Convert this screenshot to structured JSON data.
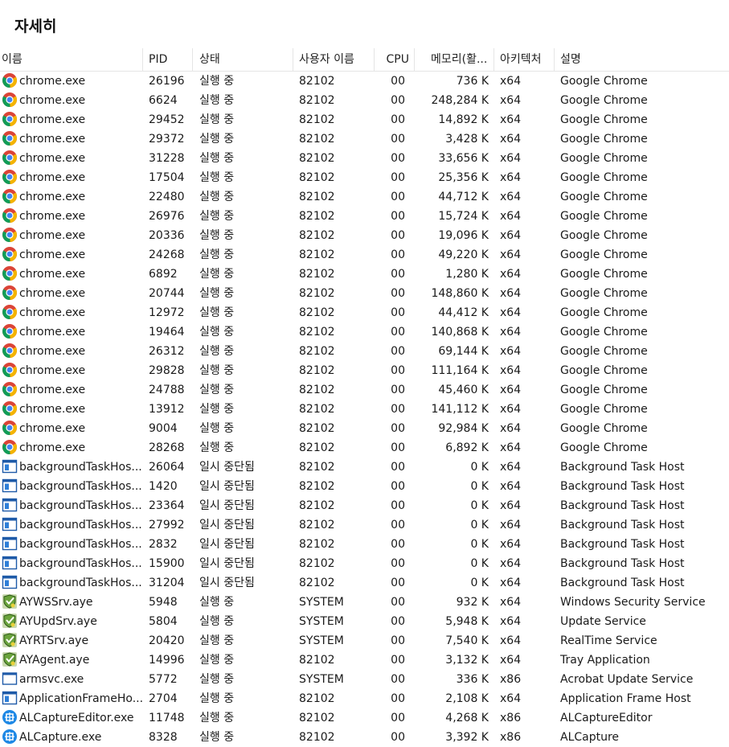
{
  "title": "자세히",
  "columns": {
    "name": "이름",
    "pid": "PID",
    "status": "상태",
    "user": "사용자 이름",
    "cpu": "CPU",
    "mem": "메모리(활...",
    "arch": "아키텍처",
    "desc": "설명"
  },
  "sort_indicator": "˅",
  "rows": [
    {
      "icon": "chrome-icon",
      "name": "chrome.exe",
      "pid": "26196",
      "status": "실행 중",
      "user": "82102",
      "cpu": "00",
      "mem": "736 K",
      "arch": "x64",
      "desc": "Google Chrome"
    },
    {
      "icon": "chrome-icon",
      "name": "chrome.exe",
      "pid": "6624",
      "status": "실행 중",
      "user": "82102",
      "cpu": "00",
      "mem": "248,284 K",
      "arch": "x64",
      "desc": "Google Chrome"
    },
    {
      "icon": "chrome-icon",
      "name": "chrome.exe",
      "pid": "29452",
      "status": "실행 중",
      "user": "82102",
      "cpu": "00",
      "mem": "14,892 K",
      "arch": "x64",
      "desc": "Google Chrome"
    },
    {
      "icon": "chrome-icon",
      "name": "chrome.exe",
      "pid": "29372",
      "status": "실행 중",
      "user": "82102",
      "cpu": "00",
      "mem": "3,428 K",
      "arch": "x64",
      "desc": "Google Chrome"
    },
    {
      "icon": "chrome-icon",
      "name": "chrome.exe",
      "pid": "31228",
      "status": "실행 중",
      "user": "82102",
      "cpu": "00",
      "mem": "33,656 K",
      "arch": "x64",
      "desc": "Google Chrome"
    },
    {
      "icon": "chrome-icon",
      "name": "chrome.exe",
      "pid": "17504",
      "status": "실행 중",
      "user": "82102",
      "cpu": "00",
      "mem": "25,356 K",
      "arch": "x64",
      "desc": "Google Chrome"
    },
    {
      "icon": "chrome-icon",
      "name": "chrome.exe",
      "pid": "22480",
      "status": "실행 중",
      "user": "82102",
      "cpu": "00",
      "mem": "44,712 K",
      "arch": "x64",
      "desc": "Google Chrome"
    },
    {
      "icon": "chrome-icon",
      "name": "chrome.exe",
      "pid": "26976",
      "status": "실행 중",
      "user": "82102",
      "cpu": "00",
      "mem": "15,724 K",
      "arch": "x64",
      "desc": "Google Chrome"
    },
    {
      "icon": "chrome-icon",
      "name": "chrome.exe",
      "pid": "20336",
      "status": "실행 중",
      "user": "82102",
      "cpu": "00",
      "mem": "19,096 K",
      "arch": "x64",
      "desc": "Google Chrome"
    },
    {
      "icon": "chrome-icon",
      "name": "chrome.exe",
      "pid": "24268",
      "status": "실행 중",
      "user": "82102",
      "cpu": "00",
      "mem": "49,220 K",
      "arch": "x64",
      "desc": "Google Chrome"
    },
    {
      "icon": "chrome-icon",
      "name": "chrome.exe",
      "pid": "6892",
      "status": "실행 중",
      "user": "82102",
      "cpu": "00",
      "mem": "1,280 K",
      "arch": "x64",
      "desc": "Google Chrome"
    },
    {
      "icon": "chrome-icon",
      "name": "chrome.exe",
      "pid": "20744",
      "status": "실행 중",
      "user": "82102",
      "cpu": "00",
      "mem": "148,860 K",
      "arch": "x64",
      "desc": "Google Chrome"
    },
    {
      "icon": "chrome-icon",
      "name": "chrome.exe",
      "pid": "12972",
      "status": "실행 중",
      "user": "82102",
      "cpu": "00",
      "mem": "44,412 K",
      "arch": "x64",
      "desc": "Google Chrome"
    },
    {
      "icon": "chrome-icon",
      "name": "chrome.exe",
      "pid": "19464",
      "status": "실행 중",
      "user": "82102",
      "cpu": "00",
      "mem": "140,868 K",
      "arch": "x64",
      "desc": "Google Chrome"
    },
    {
      "icon": "chrome-icon",
      "name": "chrome.exe",
      "pid": "26312",
      "status": "실행 중",
      "user": "82102",
      "cpu": "00",
      "mem": "69,144 K",
      "arch": "x64",
      "desc": "Google Chrome"
    },
    {
      "icon": "chrome-icon",
      "name": "chrome.exe",
      "pid": "29828",
      "status": "실행 중",
      "user": "82102",
      "cpu": "00",
      "mem": "111,164 K",
      "arch": "x64",
      "desc": "Google Chrome"
    },
    {
      "icon": "chrome-icon",
      "name": "chrome.exe",
      "pid": "24788",
      "status": "실행 중",
      "user": "82102",
      "cpu": "00",
      "mem": "45,460 K",
      "arch": "x64",
      "desc": "Google Chrome"
    },
    {
      "icon": "chrome-icon",
      "name": "chrome.exe",
      "pid": "13912",
      "status": "실행 중",
      "user": "82102",
      "cpu": "00",
      "mem": "141,112 K",
      "arch": "x64",
      "desc": "Google Chrome"
    },
    {
      "icon": "chrome-icon",
      "name": "chrome.exe",
      "pid": "9004",
      "status": "실행 중",
      "user": "82102",
      "cpu": "00",
      "mem": "92,984 K",
      "arch": "x64",
      "desc": "Google Chrome"
    },
    {
      "icon": "chrome-icon",
      "name": "chrome.exe",
      "pid": "28268",
      "status": "실행 중",
      "user": "82102",
      "cpu": "00",
      "mem": "6,892 K",
      "arch": "x64",
      "desc": "Google Chrome"
    },
    {
      "icon": "window-app-icon",
      "name": "backgroundTaskHos...",
      "pid": "26064",
      "status": "일시 중단됨",
      "user": "82102",
      "cpu": "00",
      "mem": "0 K",
      "arch": "x64",
      "desc": "Background Task Host"
    },
    {
      "icon": "window-app-icon",
      "name": "backgroundTaskHos...",
      "pid": "1420",
      "status": "일시 중단됨",
      "user": "82102",
      "cpu": "00",
      "mem": "0 K",
      "arch": "x64",
      "desc": "Background Task Host"
    },
    {
      "icon": "window-app-icon",
      "name": "backgroundTaskHos...",
      "pid": "23364",
      "status": "일시 중단됨",
      "user": "82102",
      "cpu": "00",
      "mem": "0 K",
      "arch": "x64",
      "desc": "Background Task Host"
    },
    {
      "icon": "window-app-icon",
      "name": "backgroundTaskHos...",
      "pid": "27992",
      "status": "일시 중단됨",
      "user": "82102",
      "cpu": "00",
      "mem": "0 K",
      "arch": "x64",
      "desc": "Background Task Host"
    },
    {
      "icon": "window-app-icon",
      "name": "backgroundTaskHos...",
      "pid": "2832",
      "status": "일시 중단됨",
      "user": "82102",
      "cpu": "00",
      "mem": "0 K",
      "arch": "x64",
      "desc": "Background Task Host"
    },
    {
      "icon": "window-app-icon",
      "name": "backgroundTaskHos...",
      "pid": "15900",
      "status": "일시 중단됨",
      "user": "82102",
      "cpu": "00",
      "mem": "0 K",
      "arch": "x64",
      "desc": "Background Task Host"
    },
    {
      "icon": "window-app-icon",
      "name": "backgroundTaskHos...",
      "pid": "31204",
      "status": "일시 중단됨",
      "user": "82102",
      "cpu": "00",
      "mem": "0 K",
      "arch": "x64",
      "desc": "Background Task Host"
    },
    {
      "icon": "ahnlab-shield-icon",
      "name": "AYWSSrv.aye",
      "pid": "5948",
      "status": "실행 중",
      "user": "SYSTEM",
      "cpu": "00",
      "mem": "932 K",
      "arch": "x64",
      "desc": "Windows Security Service"
    },
    {
      "icon": "ahnlab-shield-icon",
      "name": "AYUpdSrv.aye",
      "pid": "5804",
      "status": "실행 중",
      "user": "SYSTEM",
      "cpu": "00",
      "mem": "5,948 K",
      "arch": "x64",
      "desc": "Update Service"
    },
    {
      "icon": "ahnlab-shield-icon",
      "name": "AYRTSrv.aye",
      "pid": "20420",
      "status": "실행 중",
      "user": "SYSTEM",
      "cpu": "00",
      "mem": "7,540 K",
      "arch": "x64",
      "desc": "RealTime Service"
    },
    {
      "icon": "ahnlab-shield-icon",
      "name": "AYAgent.aye",
      "pid": "14996",
      "status": "실행 중",
      "user": "82102",
      "cpu": "00",
      "mem": "3,132 K",
      "arch": "x64",
      "desc": "Tray Application"
    },
    {
      "icon": "blank-window-icon",
      "name": "armsvc.exe",
      "pid": "5772",
      "status": "실행 중",
      "user": "SYSTEM",
      "cpu": "00",
      "mem": "336 K",
      "arch": "x86",
      "desc": "Acrobat Update Service"
    },
    {
      "icon": "window-app-icon",
      "name": "ApplicationFrameHo...",
      "pid": "2704",
      "status": "실행 중",
      "user": "82102",
      "cpu": "00",
      "mem": "2,108 K",
      "arch": "x64",
      "desc": "Application Frame Host"
    },
    {
      "icon": "alcapture-icon",
      "name": "ALCaptureEditor.exe",
      "pid": "11748",
      "status": "실행 중",
      "user": "82102",
      "cpu": "00",
      "mem": "4,268 K",
      "arch": "x86",
      "desc": "ALCaptureEditor"
    },
    {
      "icon": "alcapture-icon",
      "name": "ALCapture.exe",
      "pid": "8328",
      "status": "실행 중",
      "user": "82102",
      "cpu": "00",
      "mem": "3,392 K",
      "arch": "x86",
      "desc": "ALCapture"
    }
  ]
}
